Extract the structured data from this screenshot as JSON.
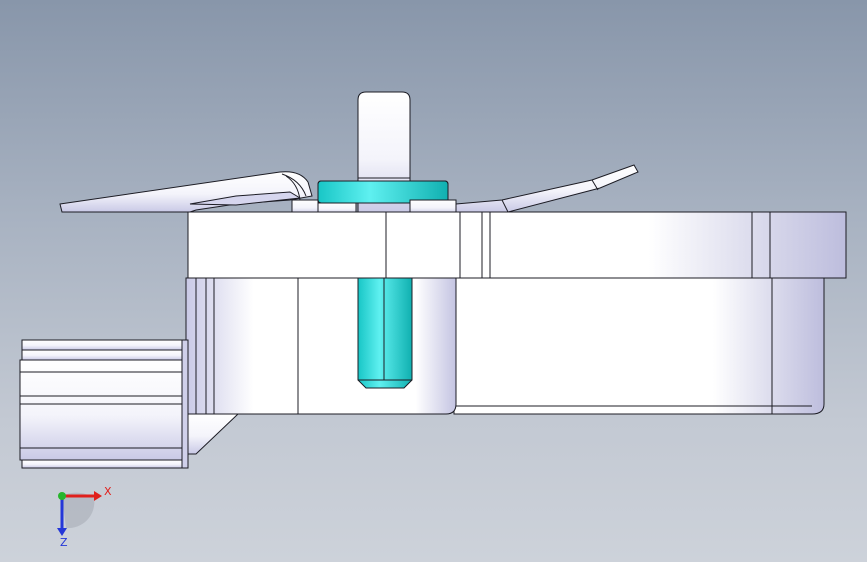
{
  "viewport": {
    "background_top": "#8896aa",
    "background_bottom": "#cdd2da",
    "model": {
      "body_color": "#ffffff",
      "edge_color": "#1c1c24",
      "shade_color": "#c9c9e6",
      "fastener_color": "#29d8d8",
      "fastener_dark": "#0fb3b3"
    }
  },
  "triad": {
    "x_label": "X",
    "z_label": "Z",
    "x_color": "#e0201c",
    "y_color": "#27b52c",
    "z_color": "#2437d8"
  }
}
